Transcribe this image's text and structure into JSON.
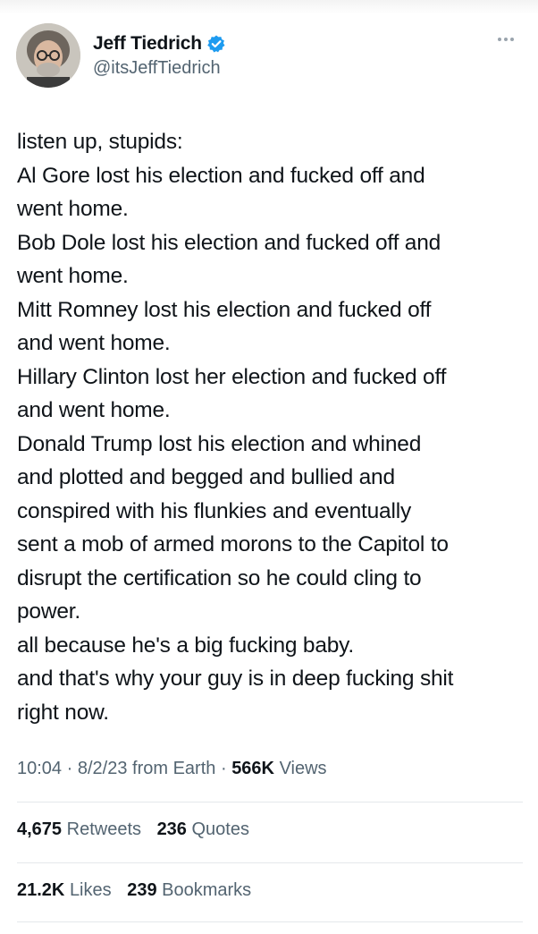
{
  "author": {
    "display_name": "Jeff Tiedrich",
    "handle": "@itsJeffTiedrich",
    "verified_color": "#1d9bf0"
  },
  "tweet": {
    "lines": [
      "listen up, stupids:",
      "Al Gore lost his election and fucked off and",
      "went home.",
      "Bob Dole lost his election and fucked off and",
      "went home.",
      "Mitt Romney lost his election and fucked off",
      "and went home.",
      "Hillary Clinton lost her election and fucked off",
      "and went home.",
      "Donald Trump lost his election and whined",
      "and plotted and begged and bullied and",
      "conspired with his flunkies and eventually",
      "sent a mob of armed morons to the Capitol to",
      "disrupt the certification so he could cling to",
      "power.",
      "all because he's a big fucking baby.",
      "and that's why your guy is in deep fucking shit",
      "right now."
    ]
  },
  "meta": {
    "time": "10:04",
    "separator": "·",
    "date": "8/2/23",
    "source": "from Earth",
    "views_count": "566K",
    "views_label": "Views"
  },
  "stats": {
    "retweets_count": "4,675",
    "retweets_label": "Retweets",
    "quotes_count": "236",
    "quotes_label": "Quotes",
    "likes_count": "21.2K",
    "likes_label": "Likes",
    "bookmarks_count": "239",
    "bookmarks_label": "Bookmarks"
  }
}
